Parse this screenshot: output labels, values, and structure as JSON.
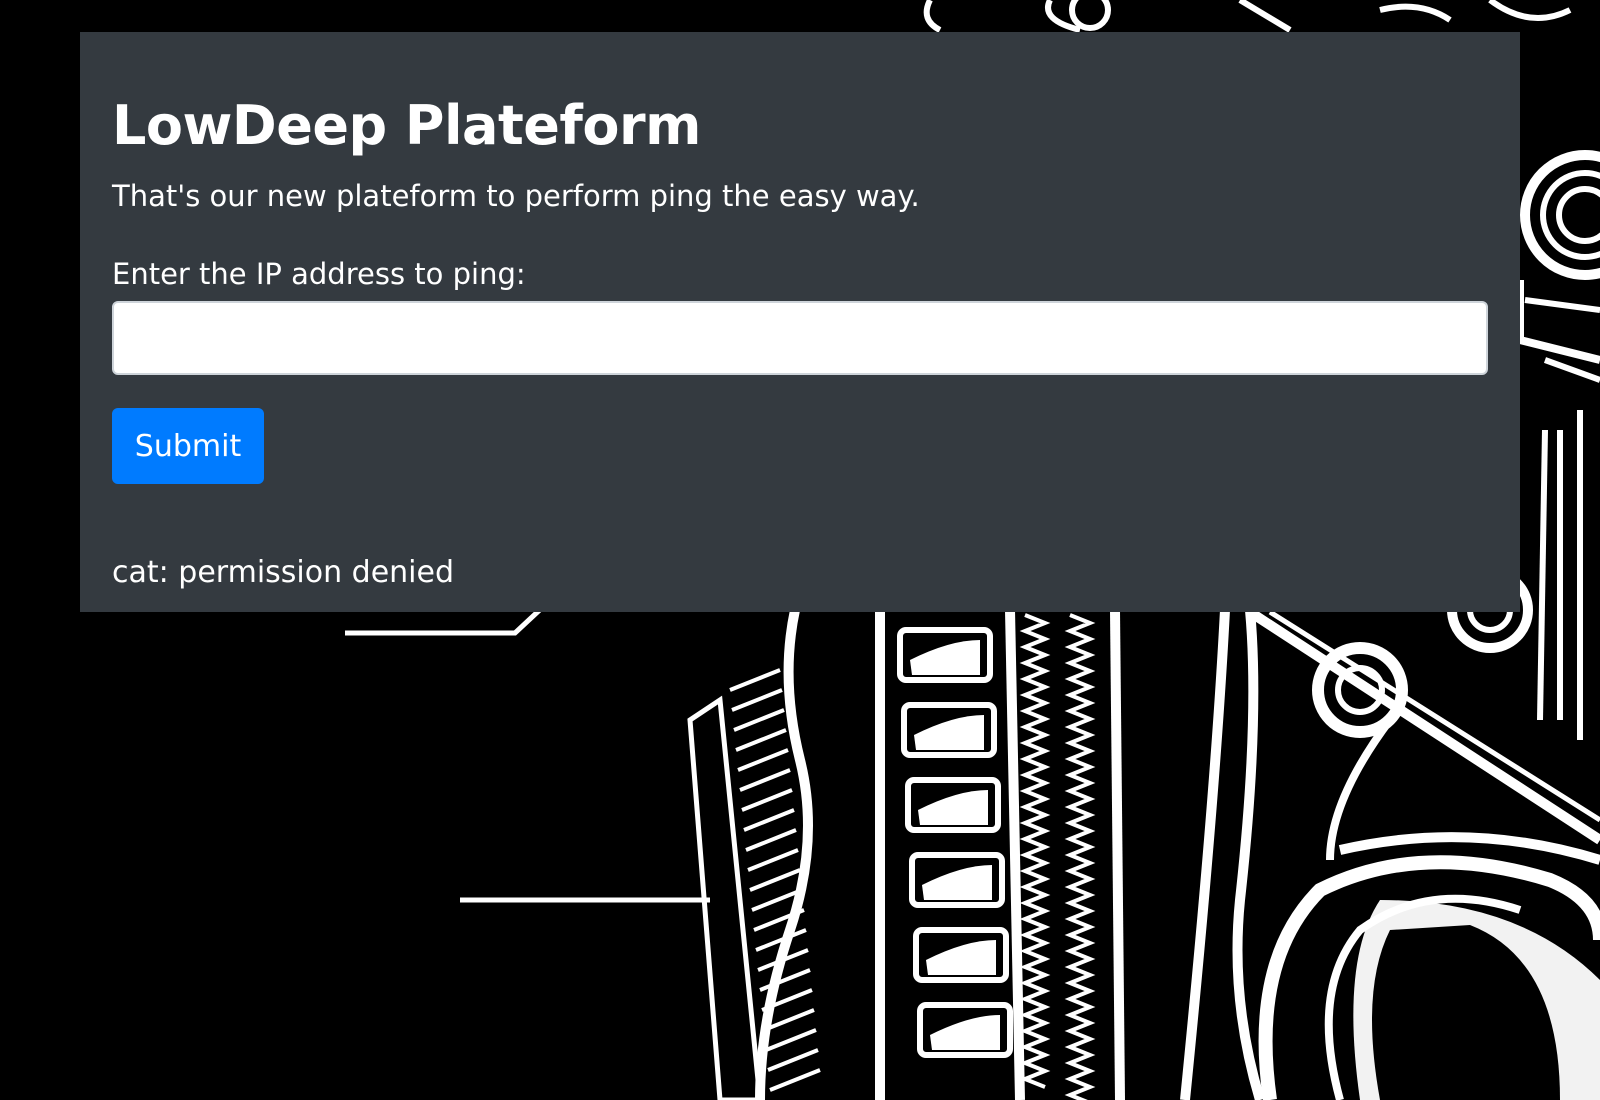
{
  "page": {
    "title": "LowDeep Plateform",
    "description": "That's our new plateform to perform ping the easy way."
  },
  "form": {
    "ip_label": "Enter the IP address to ping:",
    "ip_value": "",
    "ip_placeholder": "",
    "submit_label": "Submit"
  },
  "result": {
    "output": "cat: permission denied"
  },
  "colors": {
    "background": "#000000",
    "panel": "#343a40",
    "text": "#ffffff",
    "button": "#007bff",
    "input_border": "#ced4da"
  },
  "background_art": {
    "icon": "mechanical-engine-illustration-icon"
  }
}
